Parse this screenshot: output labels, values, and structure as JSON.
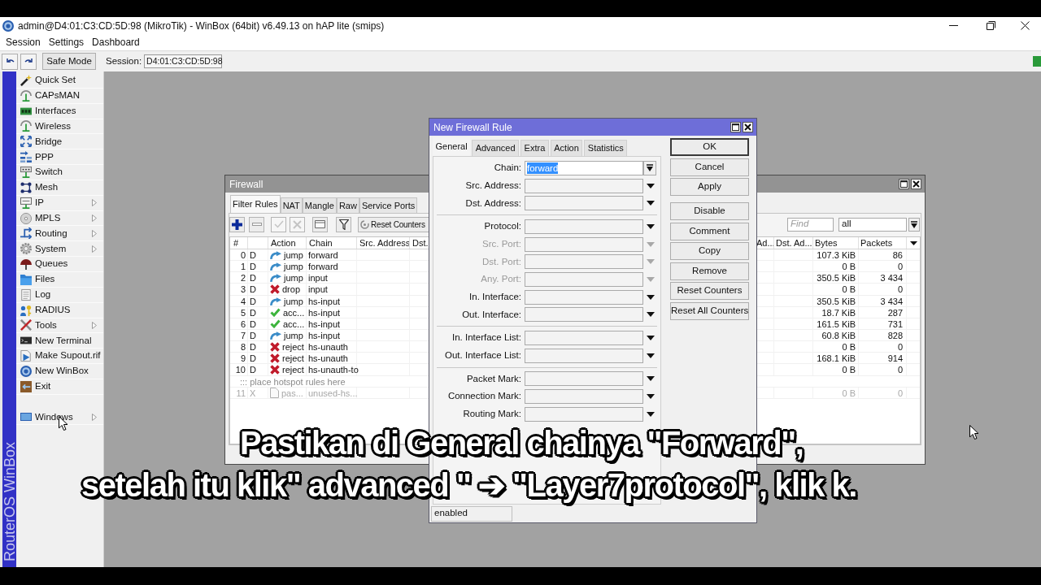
{
  "window": {
    "title": "admin@D4:01:C3:CD:5D:98 (MikroTik) - WinBox (64bit) v6.49.13 on hAP lite (smips)"
  },
  "menu": [
    {
      "label": "Session"
    },
    {
      "label": "Settings"
    },
    {
      "label": "Dashboard"
    }
  ],
  "toolbar": {
    "safe_mode": "Safe Mode",
    "session_label": "Session:",
    "session_value": "D4:01:C3:CD:5D:98"
  },
  "side_strip": {
    "label": "RouterOS WinBox"
  },
  "sidebar": {
    "items": [
      {
        "label": "Quick Set",
        "submenu": false
      },
      {
        "label": "CAPsMAN",
        "submenu": false
      },
      {
        "label": "Interfaces",
        "submenu": false
      },
      {
        "label": "Wireless",
        "submenu": false
      },
      {
        "label": "Bridge",
        "submenu": false
      },
      {
        "label": "PPP",
        "submenu": false
      },
      {
        "label": "Switch",
        "submenu": false
      },
      {
        "label": "Mesh",
        "submenu": false
      },
      {
        "label": "IP",
        "submenu": true
      },
      {
        "label": "MPLS",
        "submenu": true
      },
      {
        "label": "Routing",
        "submenu": true
      },
      {
        "label": "System",
        "submenu": true
      },
      {
        "label": "Queues",
        "submenu": false
      },
      {
        "label": "Files",
        "submenu": false
      },
      {
        "label": "Log",
        "submenu": false
      },
      {
        "label": "RADIUS",
        "submenu": false
      },
      {
        "label": "Tools",
        "submenu": true
      },
      {
        "label": "New Terminal",
        "submenu": false
      },
      {
        "label": "Make Supout.rif",
        "submenu": false
      },
      {
        "label": "New WinBox",
        "submenu": false
      },
      {
        "label": "Exit",
        "submenu": false
      }
    ],
    "bottom_items": [
      {
        "label": "Windows",
        "submenu": true
      }
    ]
  },
  "firewall": {
    "title": "Firewall",
    "tabs": [
      {
        "label": "Filter Rules",
        "selected": true
      },
      {
        "label": "NAT",
        "selected": false
      },
      {
        "label": "Mangle",
        "selected": false
      },
      {
        "label": "Raw",
        "selected": false
      },
      {
        "label": "Service Ports",
        "selected": false
      }
    ],
    "tool_buttons": [
      {
        "disabled": false
      },
      {
        "disabled": false
      },
      {
        "disabled": true
      },
      {
        "disabled": true
      },
      {
        "disabled": false
      },
      {
        "disabled": false
      }
    ],
    "reset_counters": "Reset Counters",
    "find_placeholder": "Find",
    "filter_value": "all",
    "columns_left": [
      "#",
      "Action",
      "Chain",
      "Src. Address",
      "Dst."
    ],
    "columns_right": [
      "Ad...",
      "Dst. Ad...",
      "Bytes",
      "Packets"
    ],
    "rows": [
      {
        "kind": "jump",
        "number": "0",
        "flag": "D",
        "action": "jump",
        "chain": "forward",
        "bytes": "107.3 KiB",
        "packets": "86",
        "disabled": false
      },
      {
        "kind": "jump",
        "number": "1",
        "flag": "D",
        "action": "jump",
        "chain": "forward",
        "bytes": "0 B",
        "packets": "0",
        "disabled": false
      },
      {
        "kind": "jump",
        "number": "2",
        "flag": "D",
        "action": "jump",
        "chain": "input",
        "bytes": "350.5 KiB",
        "packets": "3 434",
        "disabled": false
      },
      {
        "kind": "drop",
        "number": "3",
        "flag": "D",
        "action": "drop",
        "chain": "input",
        "bytes": "0 B",
        "packets": "0",
        "disabled": false
      },
      {
        "kind": "jump",
        "number": "4",
        "flag": "D",
        "action": "jump",
        "chain": "hs-input",
        "bytes": "350.5 KiB",
        "packets": "3 434",
        "disabled": false
      },
      {
        "kind": "accept",
        "number": "5",
        "flag": "D",
        "action": "acc...",
        "chain": "hs-input",
        "bytes": "18.7 KiB",
        "packets": "287",
        "disabled": false
      },
      {
        "kind": "accept",
        "number": "6",
        "flag": "D",
        "action": "acc...",
        "chain": "hs-input",
        "bytes": "161.5 KiB",
        "packets": "731",
        "disabled": false
      },
      {
        "kind": "jump",
        "number": "7",
        "flag": "D",
        "action": "jump",
        "chain": "hs-input",
        "bytes": "60.8 KiB",
        "packets": "828",
        "disabled": false
      },
      {
        "kind": "reject",
        "number": "8",
        "flag": "D",
        "action": "reject",
        "chain": "hs-unauth",
        "bytes": "0 B",
        "packets": "0",
        "disabled": false
      },
      {
        "kind": "reject",
        "number": "9",
        "flag": "D",
        "action": "reject",
        "chain": "hs-unauth",
        "bytes": "168.1 KiB",
        "packets": "914",
        "disabled": false
      },
      {
        "kind": "reject",
        "number": "10",
        "flag": "D",
        "action": "reject",
        "chain": "hs-unauth-to",
        "bytes": "0 B",
        "packets": "0",
        "disabled": false
      },
      {
        "kind": "comment",
        "text": "::: place hotspot rules here"
      },
      {
        "kind": "passthrough",
        "number": "11",
        "flag": "X",
        "action": "pas...",
        "chain": "unused-hs...",
        "bytes": "0 B",
        "packets": "0",
        "disabled": true
      }
    ]
  },
  "dialog": {
    "title": "New Firewall Rule",
    "tabs": [
      {
        "label": "General",
        "selected": true
      },
      {
        "label": "Advanced",
        "selected": false
      },
      {
        "label": "Extra",
        "selected": false
      },
      {
        "label": "Action",
        "selected": false
      },
      {
        "label": "Statistics",
        "selected": false
      }
    ],
    "groups": [
      [
        {
          "label": "Chain:",
          "kind": "combo",
          "value": "forward",
          "highlighted": true,
          "disabled": false
        },
        {
          "label": "Src. Address:",
          "kind": "dropdown",
          "disabled": false
        },
        {
          "label": "Dst. Address:",
          "kind": "dropdown",
          "disabled": false
        }
      ],
      [
        {
          "label": "Protocol:",
          "kind": "dropdown",
          "disabled": false
        },
        {
          "label": "Src. Port:",
          "kind": "dropdown",
          "disabled": true
        },
        {
          "label": "Dst. Port:",
          "kind": "dropdown",
          "disabled": true
        },
        {
          "label": "Any. Port:",
          "kind": "dropdown",
          "disabled": true
        },
        {
          "label": "In. Interface:",
          "kind": "dropdown",
          "disabled": false
        },
        {
          "label": "Out. Interface:",
          "kind": "dropdown",
          "disabled": false
        }
      ],
      [
        {
          "label": "In. Interface List:",
          "kind": "dropdown",
          "disabled": false
        },
        {
          "label": "Out. Interface List:",
          "kind": "dropdown",
          "disabled": false
        }
      ],
      [
        {
          "label": "Packet Mark:",
          "kind": "dropdown",
          "disabled": false
        },
        {
          "label": "Connection Mark:",
          "kind": "dropdown",
          "disabled": false
        },
        {
          "label": "Routing Mark:",
          "kind": "dropdown",
          "disabled": false
        }
      ]
    ],
    "button_groups": [
      [
        {
          "label": "OK",
          "default": true
        },
        {
          "label": "Cancel",
          "default": false
        },
        {
          "label": "Apply",
          "default": false
        }
      ],
      [
        {
          "label": "Disable",
          "default": false
        },
        {
          "label": "Comment",
          "default": false
        },
        {
          "label": "Copy",
          "default": false
        },
        {
          "label": "Remove",
          "default": false
        },
        {
          "label": "Reset Counters",
          "default": false
        },
        {
          "label": "Reset All Counters",
          "default": false
        }
      ]
    ],
    "status": "enabled"
  },
  "caption": {
    "lines": [
      "Pastikan di General chainya \"Forward\",",
      "setelah itu klik\" advanced \" ➔ \"Layer7protocol\", klik k."
    ]
  }
}
